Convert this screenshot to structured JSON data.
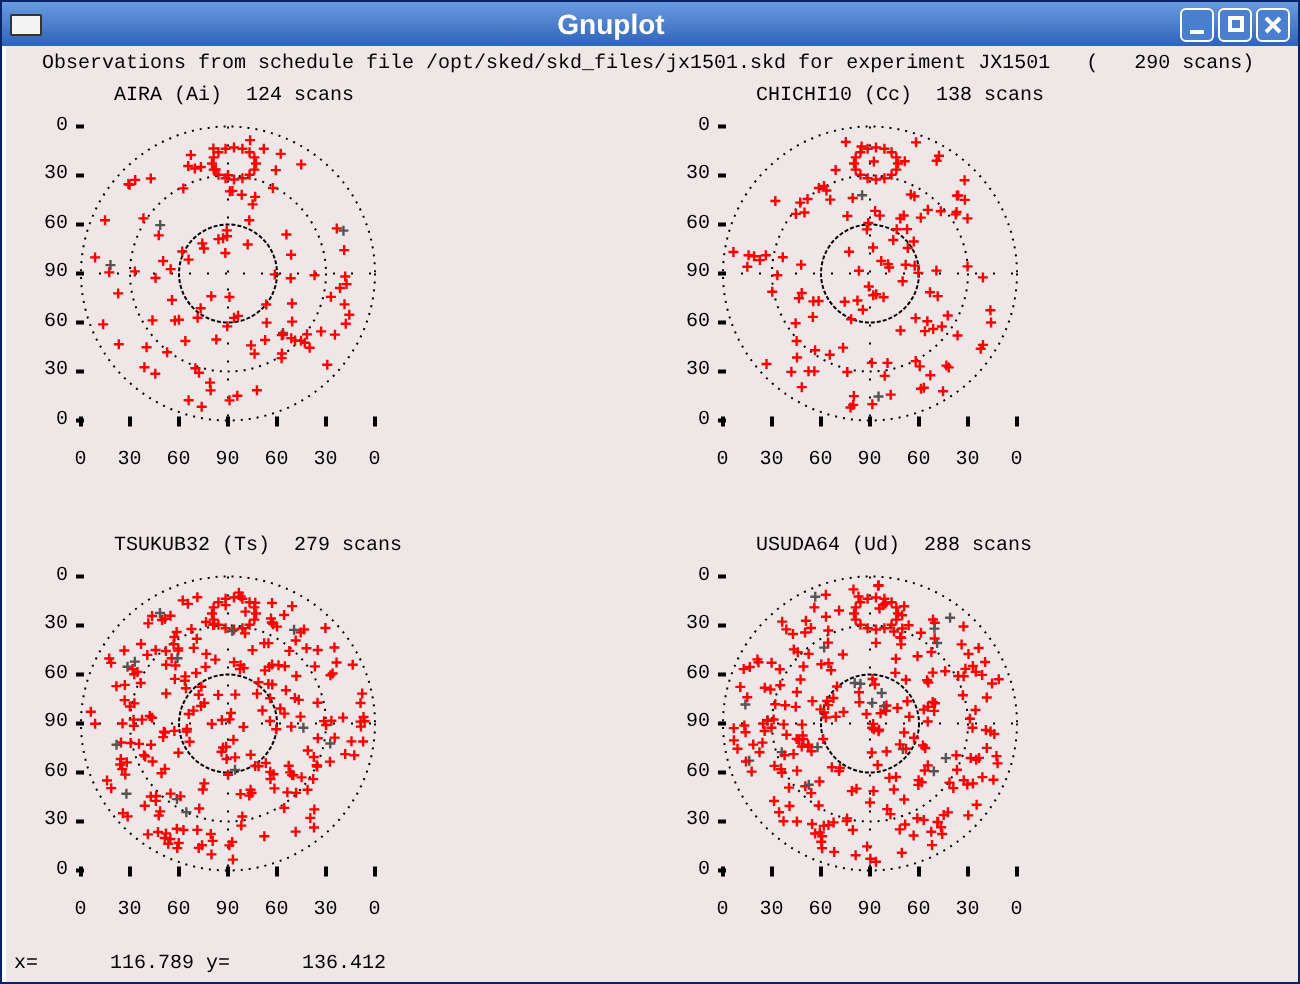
{
  "window": {
    "title": "Gnuplot"
  },
  "header": "Observations from schedule file /opt/sked/skd_files/jx1501.skd for experiment JX1501   (   290 scans)",
  "plots": [
    {
      "title": "AIRA (Ai)  124 scans",
      "y_labels": [
        "0",
        "30",
        "60",
        "90",
        "60",
        "30",
        "0"
      ],
      "x_labels": [
        "0",
        "30",
        "60",
        "90",
        "60",
        "30",
        "0"
      ]
    },
    {
      "title": "CHICHI10 (Cc)  138 scans",
      "y_labels": [
        "0",
        "30",
        "60",
        "90",
        "60",
        "30",
        "0"
      ],
      "x_labels": [
        "0",
        "30",
        "60",
        "90",
        "60",
        "30",
        "0"
      ]
    },
    {
      "title": "TSUKUB32 (Ts)  279 scans",
      "y_labels": [
        "0",
        "30",
        "60",
        "90",
        "60",
        "30",
        "0"
      ],
      "x_labels": [
        "0",
        "30",
        "60",
        "90",
        "60",
        "30",
        "0"
      ]
    },
    {
      "title": "USUDA64 (Ud)  288 scans",
      "y_labels": [
        "0",
        "30",
        "60",
        "90",
        "60",
        "30",
        "0"
      ],
      "x_labels": [
        "0",
        "30",
        "60",
        "90",
        "60",
        "30",
        "0"
      ]
    }
  ],
  "status_bar": "x=      116.789 y=      136.412"
}
